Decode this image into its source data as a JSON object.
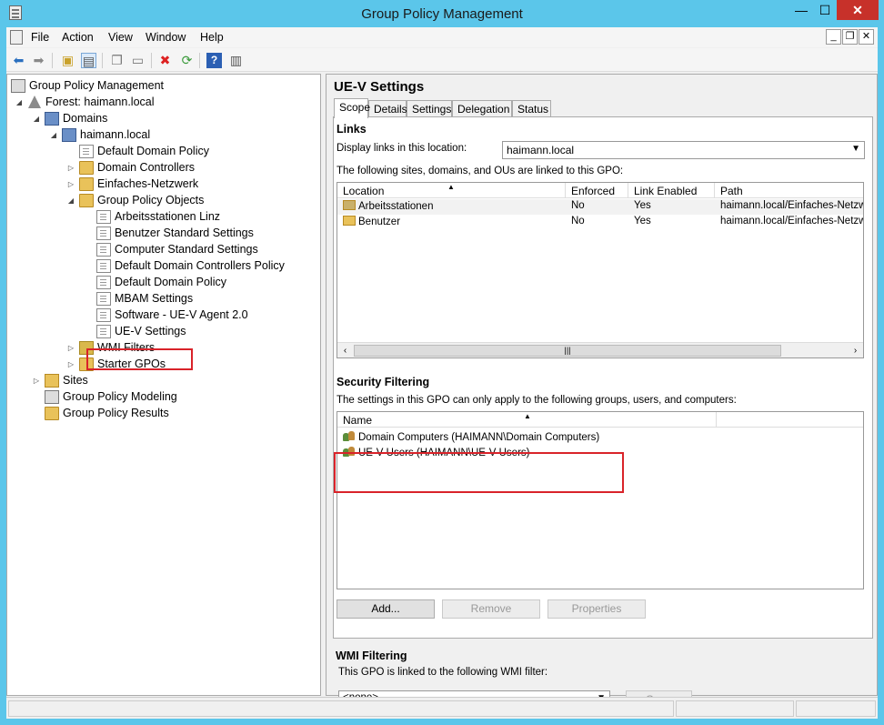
{
  "window": {
    "title": "Group Policy Management",
    "controls": {
      "minimize": "—",
      "maximize": "☐",
      "close": "✕"
    }
  },
  "menubar": {
    "items": [
      "File",
      "Action",
      "View",
      "Window",
      "Help"
    ],
    "mdi": {
      "minimize": "_",
      "restore": "❐",
      "close": "✕"
    }
  },
  "toolbar": {
    "buttons": [
      "back-arrow",
      "forward-arrow",
      "up-folder",
      "show-hide-tree",
      "copy",
      "paste",
      "delete",
      "refresh",
      "help",
      "properties-pane"
    ]
  },
  "tree": {
    "items": [
      {
        "label": "Group Policy Management",
        "icon": "gpm-icon",
        "expander": ""
      },
      {
        "label": "Forest: haimann.local",
        "icon": "forest-icon",
        "expander": "◢"
      },
      {
        "label": "Domains",
        "icon": "domains-icon",
        "expander": "◢"
      },
      {
        "label": "haimann.local",
        "icon": "domain-icon",
        "expander": "◢"
      },
      {
        "label": "Default Domain Policy",
        "icon": "gpo-link-icon",
        "expander": ""
      },
      {
        "label": "Domain Controllers",
        "icon": "ou-icon",
        "expander": "▷"
      },
      {
        "label": "Einfaches-Netzwerk",
        "icon": "ou-icon",
        "expander": "▷"
      },
      {
        "label": "Group Policy Objects",
        "icon": "folder-icon",
        "expander": "◢"
      },
      {
        "label": "Arbeitsstationen Linz",
        "icon": "gpo-icon",
        "expander": ""
      },
      {
        "label": "Benutzer Standard Settings",
        "icon": "gpo-icon",
        "expander": ""
      },
      {
        "label": "Computer Standard Settings",
        "icon": "gpo-icon",
        "expander": ""
      },
      {
        "label": "Default Domain Controllers Policy",
        "icon": "gpo-icon",
        "expander": ""
      },
      {
        "label": "Default Domain Policy",
        "icon": "gpo-icon",
        "expander": ""
      },
      {
        "label": "MBAM Settings",
        "icon": "gpo-icon",
        "expander": ""
      },
      {
        "label": "Software - UE-V Agent 2.0",
        "icon": "gpo-icon",
        "expander": ""
      },
      {
        "label": "UE-V Settings",
        "icon": "gpo-icon",
        "expander": ""
      },
      {
        "label": "WMI Filters",
        "icon": "wmi-icon",
        "expander": "▷"
      },
      {
        "label": "Starter GPOs",
        "icon": "folder-icon",
        "expander": "▷"
      },
      {
        "label": "Sites",
        "icon": "sites-icon",
        "expander": "▷"
      },
      {
        "label": "Group Policy Modeling",
        "icon": "modeling-icon",
        "expander": ""
      },
      {
        "label": "Group Policy Results",
        "icon": "results-icon",
        "expander": ""
      }
    ]
  },
  "details": {
    "title": "UE-V Settings",
    "tabs": [
      "Scope",
      "Details",
      "Settings",
      "Delegation",
      "Status"
    ],
    "active_tab": "Scope",
    "links": {
      "heading": "Links",
      "location_label": "Display links in this location:",
      "location_value": "haimann.local",
      "description": "The following sites, domains, and OUs are linked to this GPO:",
      "columns": [
        "Location",
        "Enforced",
        "Link Enabled",
        "Path"
      ],
      "rows": [
        [
          "Arbeitsstationen",
          "No",
          "Yes",
          "haimann.local/Einfaches-Netzwe"
        ],
        [
          "Benutzer",
          "No",
          "Yes",
          "haimann.local/Einfaches-Netzwe"
        ]
      ]
    },
    "security": {
      "heading": "Security Filtering",
      "description": "The settings in this GPO can only apply to the following groups, users, and computers:",
      "column": "Name",
      "rows": [
        "Domain Computers (HAIMANN\\Domain Computers)",
        "UE-V Users (HAIMANN\\UE-V Users)"
      ],
      "buttons": {
        "add": "Add...",
        "remove": "Remove",
        "properties": "Properties"
      }
    },
    "wmi": {
      "heading": "WMI Filtering",
      "description": "This GPO is linked to the following WMI filter:",
      "value": "<none>",
      "open": "Open"
    }
  },
  "colors": {
    "titlebar": "#5bc6ea",
    "close": "#c7312a",
    "highlight": "#d9232a"
  }
}
